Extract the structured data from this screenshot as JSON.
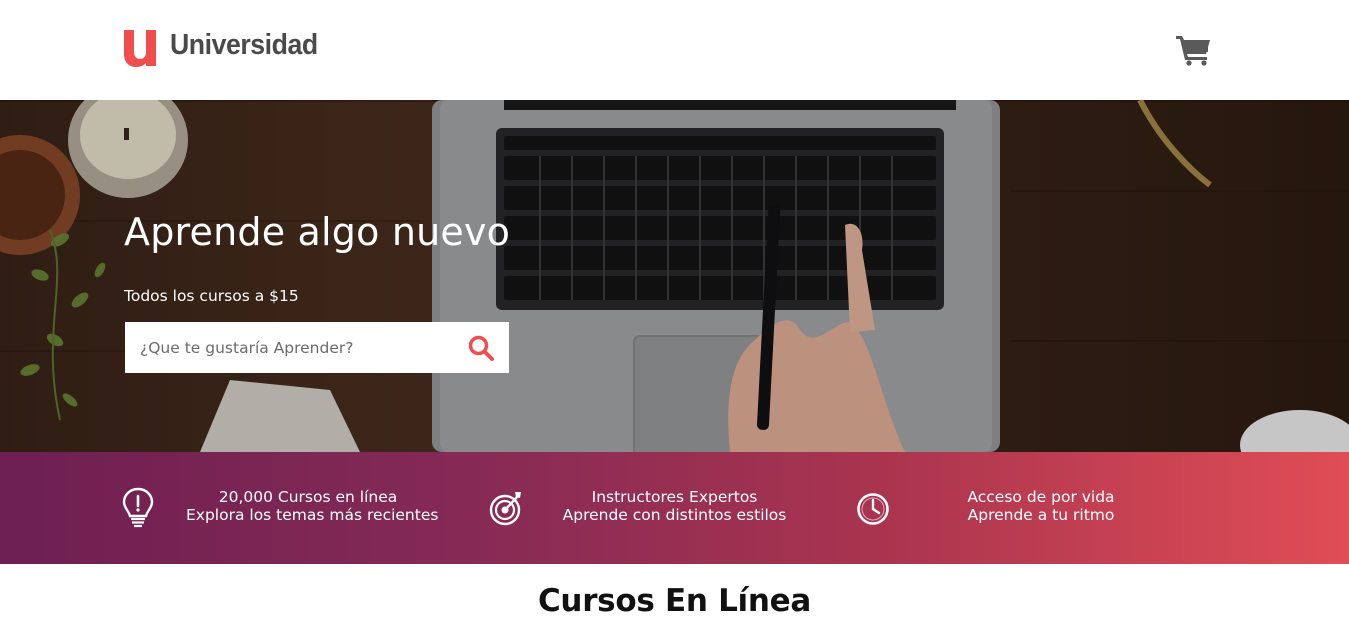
{
  "header": {
    "logo_text": "Universidad",
    "logo_mark": "u",
    "cart_icon": "shopping-cart-icon"
  },
  "hero": {
    "title": "Aprende algo nuevo",
    "subtitle": "Todos los cursos a $15",
    "search": {
      "placeholder": "¿Que te gustaría Aprender?",
      "value": "",
      "icon": "search-icon"
    }
  },
  "features": [
    {
      "icon": "lightbulb-icon",
      "line1": "20,000 Cursos en línea",
      "line2": "Explora los temas más recientes"
    },
    {
      "icon": "target-icon",
      "line1": "Instructores Expertos",
      "line2": "Aprende con distintos estilos"
    },
    {
      "icon": "clock-icon",
      "line1": "Acceso de por vida",
      "line2": "Aprende a tu ritmo"
    }
  ],
  "section": {
    "title": "Cursos En Línea"
  },
  "colors": {
    "brand": "#f04e4e",
    "gradient_start": "#6d1f52",
    "gradient_end": "#e04d55",
    "logo_text": "#4a4a4a"
  }
}
